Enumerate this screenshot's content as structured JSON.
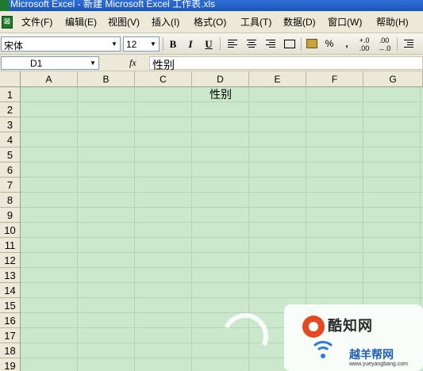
{
  "window": {
    "title": "Microsoft Excel - 新建 Microsoft Excel 工作表.xls"
  },
  "menu": {
    "items": [
      {
        "label": "文件(F)"
      },
      {
        "label": "编辑(E)"
      },
      {
        "label": "视图(V)"
      },
      {
        "label": "插入(I)"
      },
      {
        "label": "格式(O)"
      },
      {
        "label": "工具(T)"
      },
      {
        "label": "数据(D)"
      },
      {
        "label": "窗口(W)"
      },
      {
        "label": "帮助(H)"
      }
    ]
  },
  "toolbar": {
    "font_name": "宋体",
    "font_size": "12",
    "bold_label": "B",
    "italic_label": "I",
    "underline_label": "U",
    "percent_label": "%",
    "comma_label": ","
  },
  "formula_bar": {
    "name_box": "D1",
    "fx_label": "fx",
    "formula": "性别"
  },
  "sheet": {
    "columns": [
      "A",
      "B",
      "C",
      "D",
      "E",
      "F",
      "G"
    ],
    "rows": [
      "1",
      "2",
      "3",
      "4",
      "5",
      "6",
      "7",
      "8",
      "9",
      "10",
      "11",
      "12",
      "13",
      "14",
      "15",
      "16",
      "17",
      "18",
      "19"
    ],
    "cells": {
      "D1": "性别"
    },
    "active_cell": "D1",
    "background_color": "#cce8cc"
  },
  "watermark": {
    "brand_1": "酷知网",
    "brand_2": "越羊帮网",
    "url": "www.yueyangbang.com"
  }
}
